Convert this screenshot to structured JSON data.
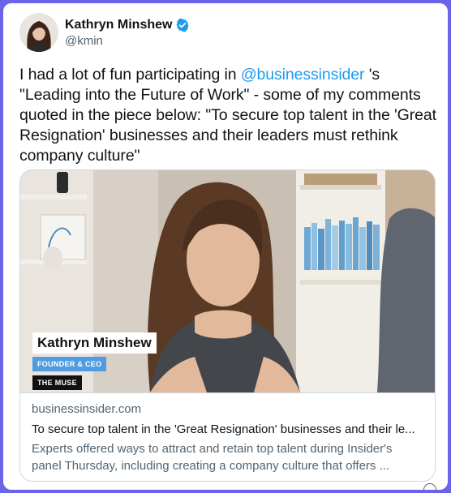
{
  "author": {
    "display_name": "Kathryn Minshew",
    "handle": "@kmin",
    "avatar_icon": "profile-photo",
    "verified_icon": "verified-badge-icon"
  },
  "tweet": {
    "text_before": "I had a lot of fun participating in ",
    "mention": "@businessinsider",
    "text_after": " 's \"Leading into the Future of Work\" - some of my comments quoted in the piece below: \"To secure top talent in the 'Great Resignation' businesses and their leaders must rethink company culture\""
  },
  "card": {
    "video_lower_third": {
      "name": "Kathryn Minshew",
      "role": "FOUNDER & CEO",
      "company": "THE MUSE"
    },
    "domain": "businessinsider.com",
    "title": "To secure top talent in the 'Great Resignation' businesses and their le...",
    "description": "Experts offered ways to attract and retain top talent during Insider's panel Thursday, including creating a company culture that offers ..."
  },
  "colors": {
    "border": "#6b63e8",
    "link": "#1d9bf0",
    "verified": "#1d9bf0",
    "role_banner": "#4f9de0"
  }
}
